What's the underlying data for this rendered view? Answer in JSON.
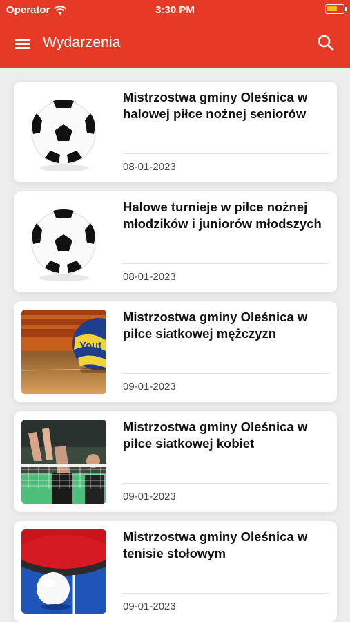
{
  "status_bar": {
    "carrier": "Operator",
    "time": "3:30 PM"
  },
  "header": {
    "title": "Wydarzenia",
    "background_color": "#e53a25"
  },
  "events": [
    {
      "title": "Mistrzostwa gminy Oleśnica w halowej piłce nożnej seniorów",
      "date": "08-01-2023",
      "image": "soccer-ball"
    },
    {
      "title": "Halowe turnieje w piłce nożnej młodzików i juniorów młodszych",
      "date": "08-01-2023",
      "image": "soccer-ball"
    },
    {
      "title": "Mistrzostwa gminy Oleśnica w piłce siatkowej mężczyzn",
      "date": "09-01-2023",
      "image": "volleyball-court"
    },
    {
      "title": "Mistrzostwa gminy Oleśnica w piłce siatkowej kobiet",
      "date": "09-01-2023",
      "image": "volleyball-net"
    },
    {
      "title": "Mistrzostwa gminy Oleśnica w tenisie stołowym",
      "date": "09-01-2023",
      "image": "table-tennis"
    }
  ]
}
